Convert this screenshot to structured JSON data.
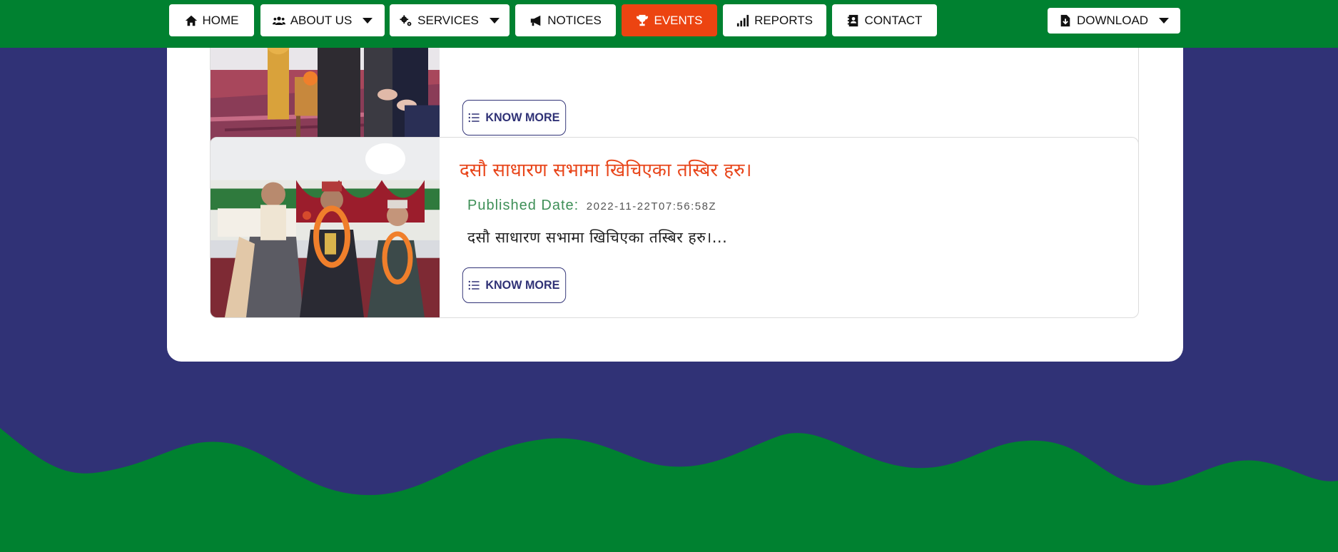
{
  "nav": {
    "items": [
      {
        "label": "HOME"
      },
      {
        "label": "ABOUT US"
      },
      {
        "label": "SERVICES"
      },
      {
        "label": "NOTICES"
      },
      {
        "label": "EVENTS"
      },
      {
        "label": "REPORTS"
      },
      {
        "label": "CONTACT"
      }
    ],
    "download_label": "DOWNLOAD",
    "active_color": "#ec4411",
    "bar_color": "#008130"
  },
  "events": [
    {
      "know_more_label": "KNOW MORE"
    },
    {
      "title": "दसौ साधारण सभामा खिचिएका तस्बिर हरु।",
      "published_label": "Published Date:",
      "published_date": "2022-11-22T07:56:58Z",
      "excerpt": "दसौ साधारण सभामा खिचिएका तस्बिर हरु।...",
      "know_more_label": "KNOW MORE"
    }
  ],
  "colors": {
    "page_bg": "#303276",
    "title": "#e8461b",
    "meta": "#3e8f57",
    "footer_wave": "#008130"
  }
}
